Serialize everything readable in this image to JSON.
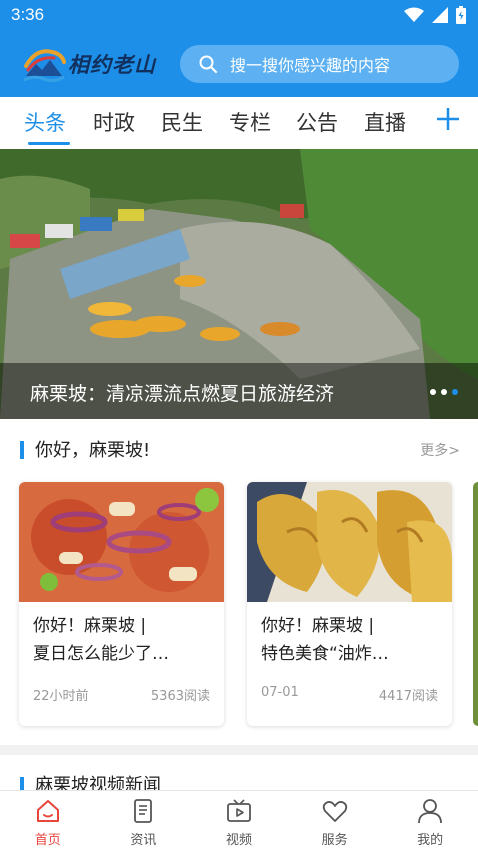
{
  "status_bar": {
    "time": "3:36"
  },
  "header": {
    "logo_text": "相约老山",
    "search_placeholder": "搜一搜你感兴趣的内容"
  },
  "tabs": [
    {
      "label": "头条",
      "active": true
    },
    {
      "label": "时政"
    },
    {
      "label": "民生"
    },
    {
      "label": "专栏"
    },
    {
      "label": "公告"
    },
    {
      "label": "直播"
    }
  ],
  "banner": {
    "caption": "麻栗坡：清凉漂流点燃夏日旅游经济",
    "slide_count": 3,
    "active_slide": 3
  },
  "section": {
    "title": "你好，麻栗坡!",
    "more": "更多>"
  },
  "cards": [
    {
      "title_line1": "你好！麻栗坡 |",
      "title_line2": "夏日怎么能少了…",
      "time": "22小时前",
      "reads": "5363阅读"
    },
    {
      "title_line1": "你好！麻栗坡 |",
      "title_line2": "特色美食“油炸…",
      "time": "07-01",
      "reads": "4417阅读"
    }
  ],
  "section2": {
    "title": "麻栗坡视频新闻"
  },
  "bottom_nav": [
    {
      "label": "首页",
      "icon": "home-icon",
      "active": true
    },
    {
      "label": "资讯",
      "icon": "news-icon"
    },
    {
      "label": "视频",
      "icon": "video-icon"
    },
    {
      "label": "服务",
      "icon": "heart-icon"
    },
    {
      "label": "我的",
      "icon": "user-icon"
    }
  ],
  "colors": {
    "brand": "#1e8fe8",
    "nav_active": "#e8453c"
  }
}
